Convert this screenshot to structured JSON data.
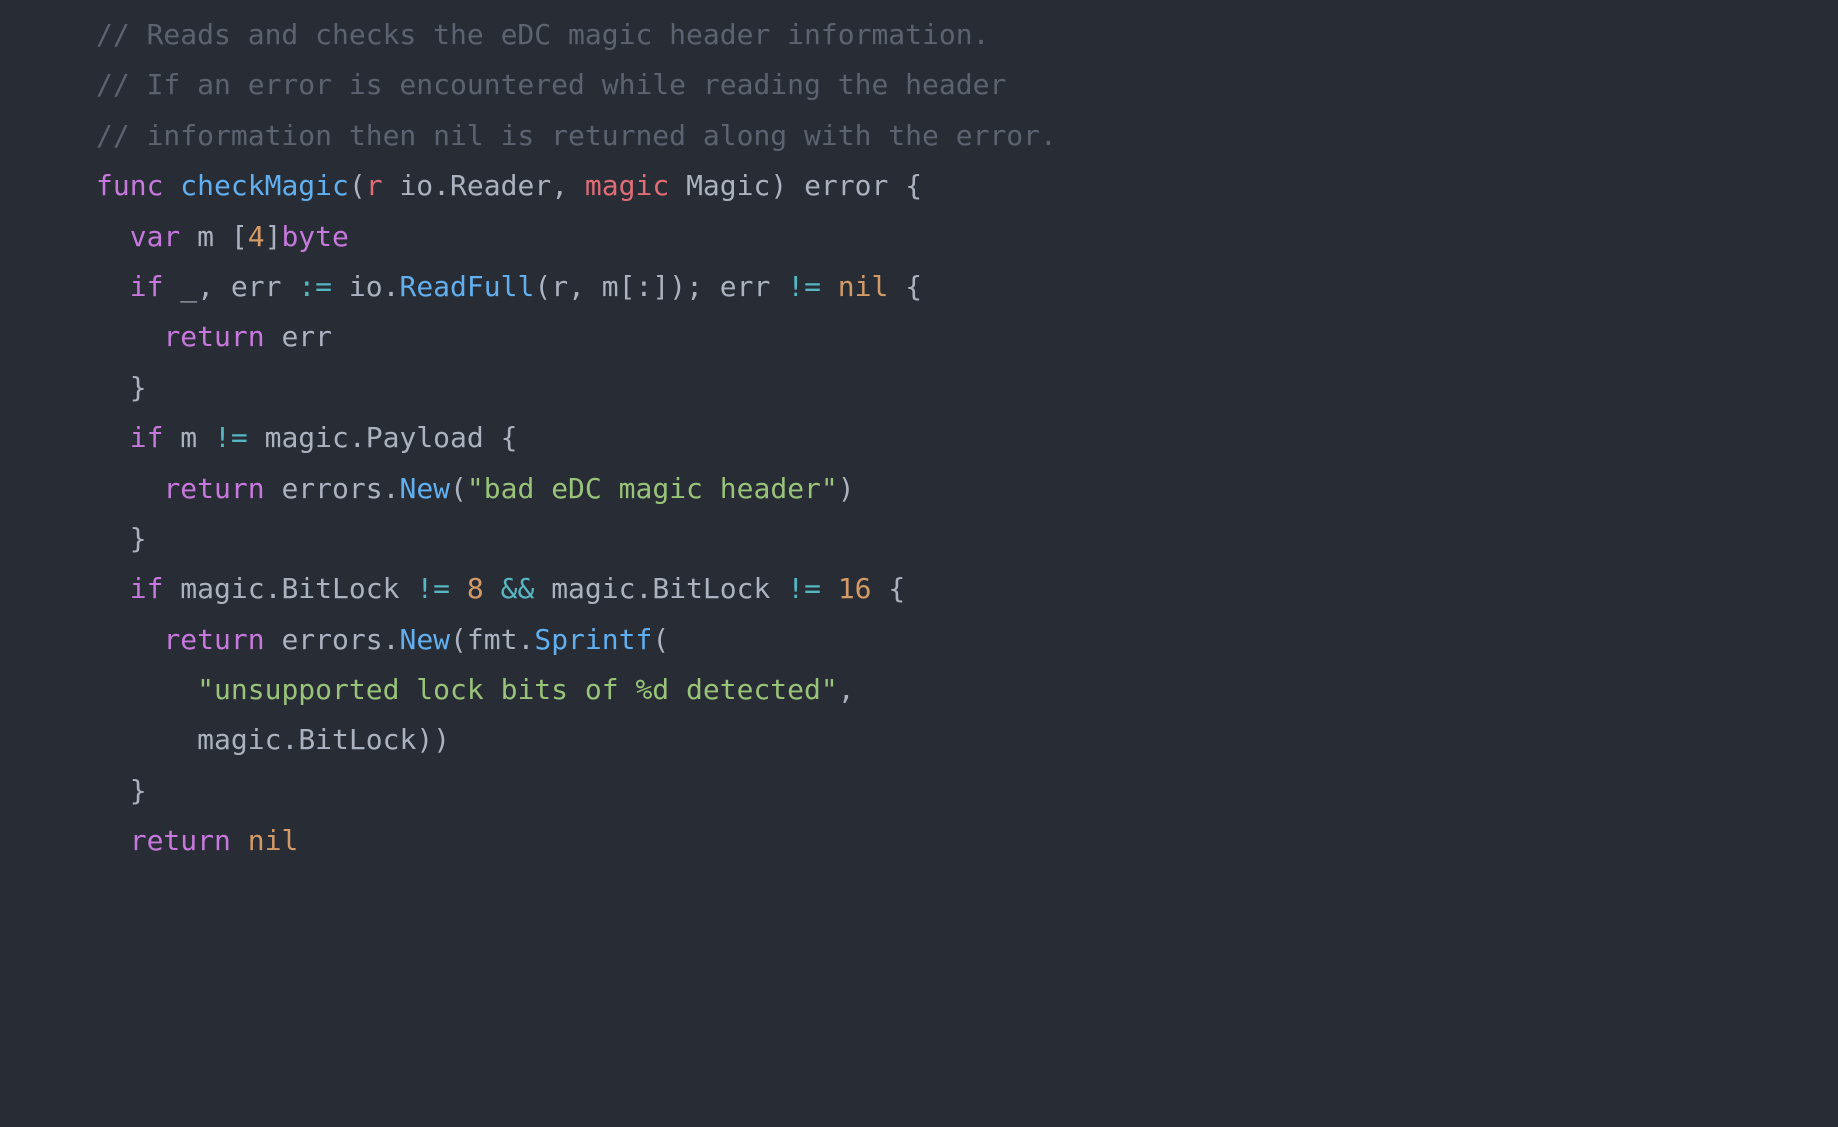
{
  "code": {
    "comment1": "// Reads and checks the eDC magic header information.",
    "comment2": "// If an error is encountered while reading the header",
    "comment3": "// information then nil is returned along with the error.",
    "kw_func": "func",
    "fn_name": "checkMagic",
    "lparen1": "(",
    "param_r": "r",
    "sp": " ",
    "type_io": "io",
    "dot1": ".",
    "type_reader": "Reader",
    "comma1": ", ",
    "param_magic": "magic",
    "type_magic": "Magic",
    "rparen1": ")",
    "type_error": "error",
    "lbrace1": "{",
    "kw_var": "var",
    "ident_m": "m",
    "lbracket1": "[",
    "num_4": "4",
    "rbracket1": "]",
    "type_byte": "byte",
    "kw_if1": "if",
    "ident_underscore": "_",
    "comma2": ", ",
    "ident_err": "err",
    "op_assign": ":=",
    "ident_io": "io",
    "dot2": ".",
    "fn_readfull": "ReadFull",
    "lparen2": "(",
    "ident_r": "r",
    "comma3": ", ",
    "ident_m2": "m",
    "lbracket2": "[",
    "colon1": ":",
    "rbracket2": "]",
    "rparen2": ")",
    "semi1": "; ",
    "ident_err2": "err",
    "op_ne1": "!=",
    "const_nil1": "nil",
    "lbrace2": "{",
    "kw_return1": "return",
    "ident_err3": "err",
    "rbrace1": "}",
    "kw_if2": "if",
    "ident_m3": "m",
    "op_ne2": "!=",
    "ident_magic1": "magic",
    "dot3": ".",
    "field_payload": "Payload",
    "lbrace3": "{",
    "kw_return2": "return",
    "ident_errors1": "errors",
    "dot4": ".",
    "fn_new1": "New",
    "lparen3": "(",
    "str_bad": "\"bad eDC magic header\"",
    "rparen3": ")",
    "rbrace2": "}",
    "kw_if3": "if",
    "ident_magic2": "magic",
    "dot5": ".",
    "field_bitlock1": "BitLock",
    "op_ne3": "!=",
    "num_8": "8",
    "op_and": "&&",
    "ident_magic3": "magic",
    "dot6": ".",
    "field_bitlock2": "BitLock",
    "op_ne4": "!=",
    "num_16": "16",
    "lbrace4": "{",
    "kw_return3": "return",
    "ident_errors2": "errors",
    "dot7": ".",
    "fn_new2": "New",
    "lparen4": "(",
    "ident_fmt": "fmt",
    "dot8": ".",
    "fn_sprintf": "Sprintf",
    "lparen5": "(",
    "str_unsupported": "\"unsupported lock bits of %d detected\"",
    "comma4": ",",
    "ident_magic4": "magic",
    "dot9": ".",
    "field_bitlock3": "BitLock",
    "rparen5": ")",
    "rparen4": ")",
    "rbrace3": "}",
    "kw_return4": "return",
    "const_nil2": "nil"
  }
}
